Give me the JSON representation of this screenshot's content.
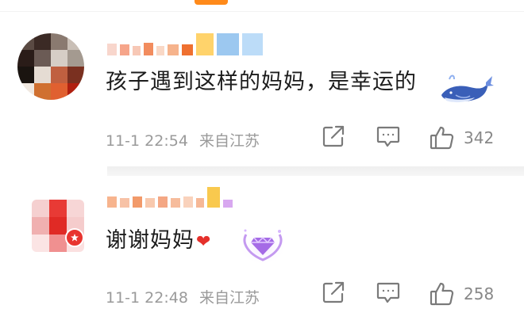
{
  "comments": [
    {
      "text": "孩子遇到这样的妈妈，是幸运的",
      "time": "11-1 22:54",
      "location": "来自江苏",
      "like_count": "342",
      "avatar_pixels": [
        "#5a4a43",
        "#3b2a25",
        "#8a7a70",
        "#c9bfb6",
        "#2a1c18",
        "#6b5b55",
        "#d6cec6",
        "#a49a90",
        "#1a1410",
        "#e5dcd3",
        "#c06040",
        "#7a3020",
        "#f0e8e0",
        "#d07030",
        "#e06030",
        "#b02010"
      ],
      "nick_pixels": [
        {
          "w": 12,
          "h": 15,
          "c": "#f8d6cc"
        },
        {
          "w": 12,
          "h": 14,
          "c": "#f6a58a"
        },
        {
          "w": 10,
          "h": 12,
          "c": "#f7c8b6"
        },
        {
          "w": 12,
          "h": 16,
          "c": "#f28c5e"
        },
        {
          "w": 10,
          "h": 12,
          "c": "#f9d8c6"
        },
        {
          "w": 14,
          "h": 14,
          "c": "#f6b38c"
        },
        {
          "w": 14,
          "h": 14,
          "c": "#ef7030"
        },
        {
          "w": 22,
          "h": 28,
          "c": "#ffd36b"
        },
        {
          "w": 28,
          "h": 28,
          "c": "#9cc8f0"
        },
        {
          "w": 26,
          "h": 28,
          "c": "#bcdcf8"
        }
      ]
    },
    {
      "text": "谢谢妈妈",
      "time": "11-1 22:48",
      "location": "来自江苏",
      "like_count": "258",
      "avatar_pixels": [
        "#f5d0d0",
        "#e83a35",
        "#f7d6d6",
        "#f0b0b0",
        "#e02a25",
        "#f5cccc",
        "#fbe4e4",
        "#f09090",
        "#fbe0e0"
      ],
      "nick_pixels": [
        {
          "w": 12,
          "h": 14,
          "c": "#f7b48e"
        },
        {
          "w": 12,
          "h": 12,
          "c": "#f7c2a6"
        },
        {
          "w": 12,
          "h": 14,
          "c": "#f29a6a"
        },
        {
          "w": 12,
          "h": 12,
          "c": "#f8c9ae"
        },
        {
          "w": 12,
          "h": 14,
          "c": "#f4a784"
        },
        {
          "w": 12,
          "h": 12,
          "c": "#f6bc9c"
        },
        {
          "w": 12,
          "h": 14,
          "c": "#f9d2bc"
        },
        {
          "w": 10,
          "h": 12,
          "c": "#f6b896"
        },
        {
          "w": 16,
          "h": 26,
          "c": "#f9c94e"
        },
        {
          "w": 12,
          "h": 10,
          "c": "#d8a8f0"
        }
      ]
    }
  ],
  "colors": {
    "accent": "#ff8a1a",
    "badge": "#e8342f",
    "heart": "#e5302b",
    "meta": "#9a9a9a",
    "icon": "#7a7a7a"
  },
  "icons": {
    "share": "share-icon",
    "comment": "comment-icon",
    "like": "thumbs-up-icon",
    "badge": "verified-star-badge-icon",
    "heart": "heart-emoji-icon",
    "whale_sticker": "whale-sticker",
    "diamond_sticker": "diamond-heart-sticker"
  }
}
